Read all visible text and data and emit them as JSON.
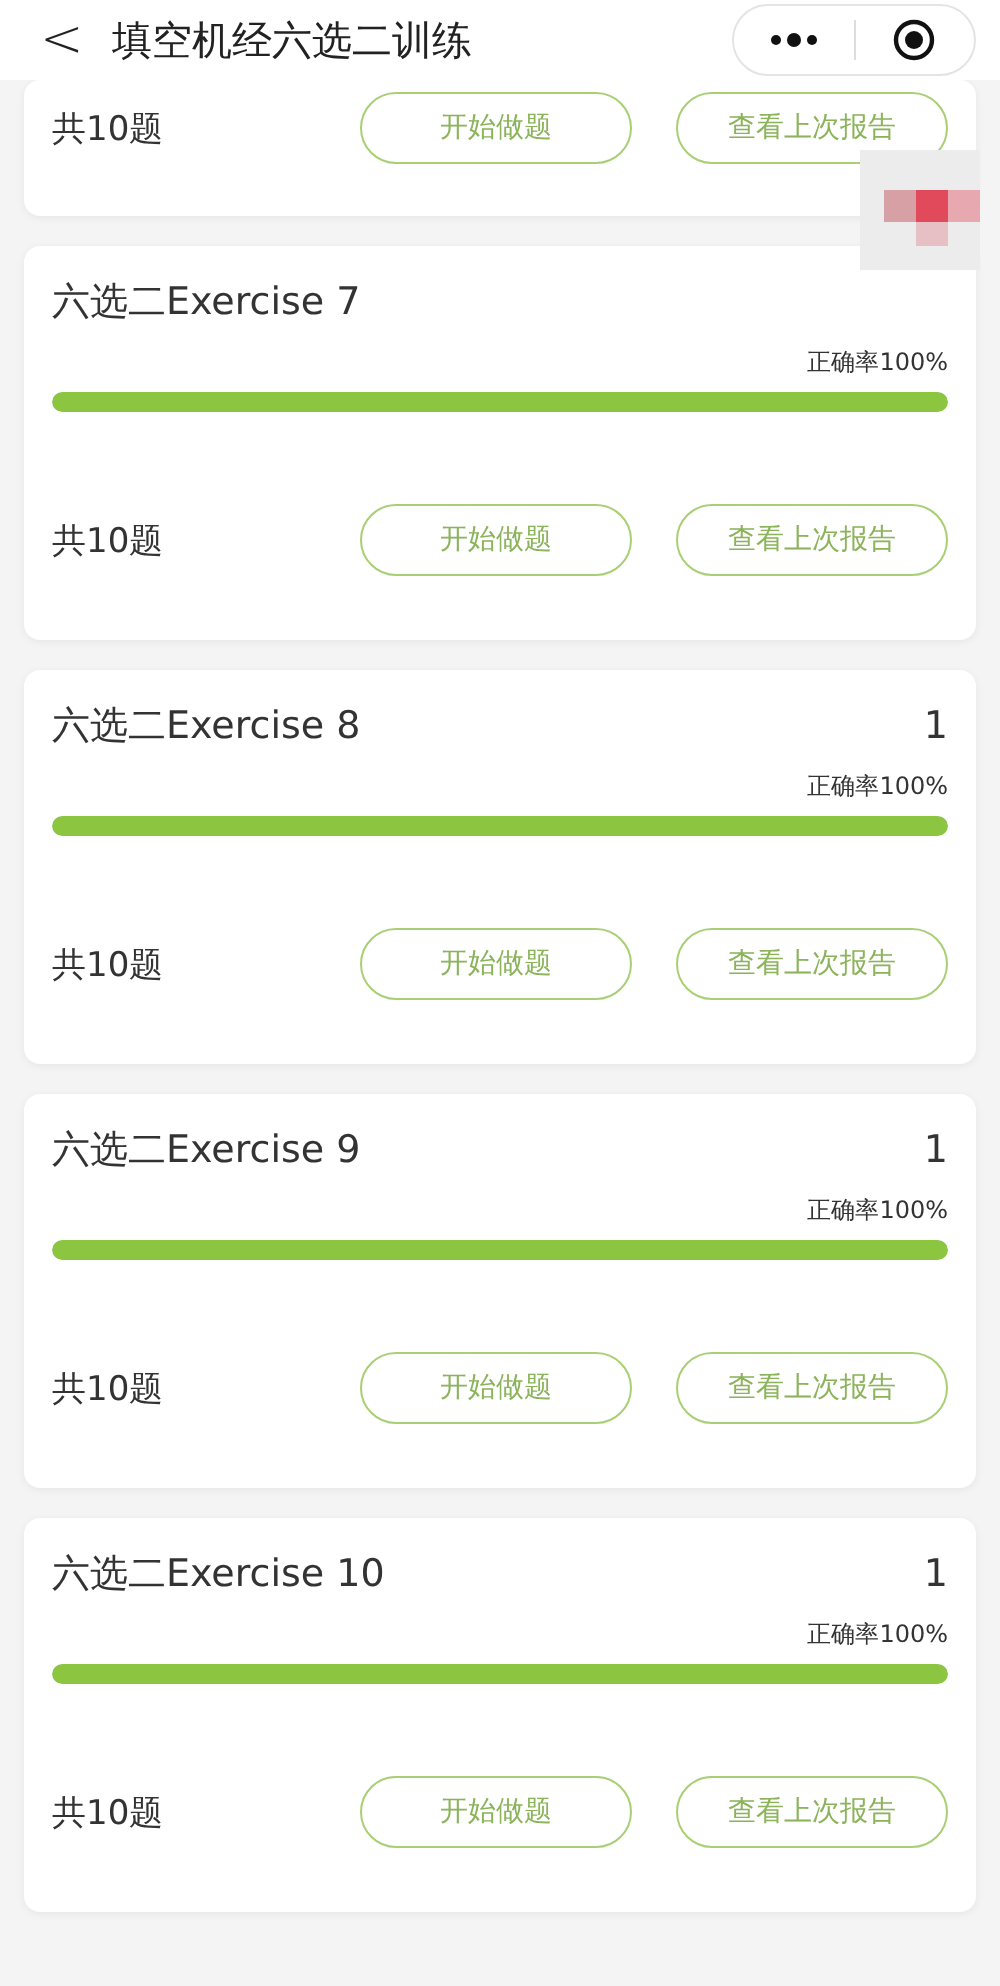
{
  "header": {
    "back": "<",
    "title": "填空机经六选二训练"
  },
  "cards": [
    {
      "kind": "partial",
      "total": "共10题",
      "buttons": [
        "开始做题",
        "查看上次报告"
      ]
    },
    {
      "kind": "full",
      "title": "六选二Exercise 7",
      "accuracy": "正确率100%",
      "level": 1,
      "total": "共10题",
      "buttons": [
        "开始做题",
        "查看上次报告"
      ]
    },
    {
      "kind": "full",
      "title": "六选二Exercise 8",
      "score": "1",
      "accuracy": "正确率100%",
      "level": 1,
      "total": "共10题",
      "buttons": [
        "开始做题",
        "查看上次报告"
      ]
    },
    {
      "kind": "full",
      "title": "六选二Exercise 9",
      "score": "1",
      "accuracy": "正确率100%",
      "level": 1,
      "total": "共10题",
      "buttons": [
        "开始做题",
        "查看上次报告"
      ]
    },
    {
      "kind": "full",
      "title": "六选二Exercise 10",
      "score": "1",
      "accuracy": "正确率100%",
      "level": 1,
      "total": "共10题",
      "buttons": [
        "开始做题",
        "查看上次报告"
      ]
    }
  ]
}
